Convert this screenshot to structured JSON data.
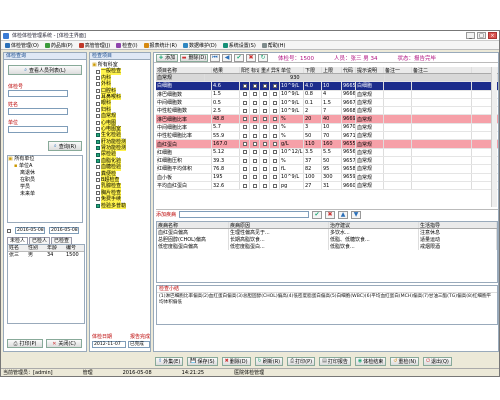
{
  "window": {
    "title": "体检体检管理系统 - [体检主界面]"
  },
  "menu": [
    {
      "label": "体检管理(O)",
      "color": "#2b6fb8"
    },
    {
      "label": "药品库(P)",
      "color": "#3a9a3a"
    },
    {
      "label": "高管管理(J)",
      "color": "#c0392b"
    },
    {
      "label": "检查(I)",
      "color": "#8e44ad"
    },
    {
      "label": "报表统计(R)",
      "color": "#d68910"
    },
    {
      "label": "数据维护(D)",
      "color": "#2e86c1"
    },
    {
      "label": "系统设置(S)",
      "color": "#148f77"
    },
    {
      "label": "帮助(H)",
      "color": "#7f8c8d"
    }
  ],
  "left": {
    "header": "体检查询",
    "person_button": "查看人员列表(L)",
    "fields": [
      {
        "label": "体检号"
      },
      {
        "label": "姓名"
      },
      {
        "label": "单位"
      }
    ],
    "search_button": "查询(R)",
    "tree": [
      "所有单位",
      "单位A",
      "离退休",
      "在职员",
      "学员",
      "未来单"
    ],
    "date_from": "2016-05-08",
    "date_to": "2016-05-08",
    "tabs": [
      "未检人",
      "已检人",
      "已检查"
    ],
    "list_header": [
      "姓名",
      "性别",
      "年龄",
      "编号"
    ],
    "list_rows": [
      [
        "张三",
        "男",
        "34",
        "1500"
      ]
    ],
    "print_button": "打印(P)",
    "close_button": "关闭(C)"
  },
  "middle": {
    "header": "检查项目",
    "dept_root": "所有科室",
    "depts": [
      "一般检查",
      "内科",
      "外科",
      "口腔科",
      "耳鼻喉科",
      "眼科",
      "妇科",
      "血常规",
      "心电图",
      "心电图室",
      "生化检验",
      "肝功能检测",
      "肾功能检测",
      "尿检验",
      "血脂化验",
      "血糖检验",
      "粪便检",
      "B超检查",
      "乳腺检查",
      "胸片检查",
      "免费手续",
      "检验多普勒"
    ],
    "checked": [
      false,
      false,
      false,
      false,
      false,
      false,
      false,
      false,
      false,
      false,
      true,
      true,
      true,
      true,
      true,
      false,
      false,
      false,
      false,
      false,
      false,
      true
    ],
    "exam_date_label": "体检日期",
    "exam_date": "2012-11-07",
    "report_label": "报告完成",
    "report_val": "已完成"
  },
  "right": {
    "header": "检查项目",
    "tool_labels": [
      "添加",
      "删除(D)"
    ],
    "info": "体检号：1500",
    "info2": "人员：张三  男  34",
    "info3": "状态：报告完毕",
    "grid_header": [
      "项目名称",
      "结果",
      "阳性",
      "标记",
      "重点",
      "异常",
      "单位",
      "下限",
      "上限",
      "代码",
      "提示说明",
      "备注一",
      "备注二"
    ],
    "section": "血常规",
    "section_val": "930",
    "rows": [
      {
        "cells": [
          "白细胞",
          "4.6",
          "",
          "",
          "",
          "",
          "10^9/L",
          "4.0",
          "10",
          "9665",
          "白细胞",
          "",
          ""
        ],
        "style": "sel"
      },
      {
        "cells": [
          "淋巴细胞数",
          "1.5",
          "",
          "",
          "",
          "",
          "10^9/L",
          "0.8",
          "4",
          "9666",
          "血常规",
          "",
          ""
        ],
        "style": "wh"
      },
      {
        "cells": [
          "中间细胞数",
          "0.5",
          "",
          "",
          "",
          "",
          "10^9/L",
          "0.1",
          "1.5",
          "9667",
          "血常规",
          "",
          ""
        ],
        "style": "wh"
      },
      {
        "cells": [
          "中性粒细胞数",
          "2.5",
          "",
          "",
          "",
          "",
          "10^9/L",
          "2",
          "7",
          "9668",
          "血常规",
          "",
          ""
        ],
        "style": "wh"
      },
      {
        "cells": [
          "淋巴细胞比率",
          "48.8",
          "",
          "",
          "",
          "",
          "%",
          "20",
          "40",
          "9669",
          "血常规",
          "",
          ""
        ],
        "style": "red"
      },
      {
        "cells": [
          "中间细胞比率",
          "5.7",
          "",
          "",
          "",
          "",
          "%",
          "3",
          "10",
          "9670",
          "血常规",
          "",
          ""
        ],
        "style": "wh"
      },
      {
        "cells": [
          "中性粒细胞比率",
          "55.9",
          "",
          "",
          "",
          "",
          "%",
          "50",
          "70",
          "9671",
          "血常规",
          "",
          ""
        ],
        "style": "wh"
      },
      {
        "cells": [
          "血红蛋白",
          "167.0",
          "",
          "",
          "",
          "",
          "g/L",
          "110",
          "160",
          "9655",
          "血常规",
          "",
          ""
        ],
        "style": "red"
      },
      {
        "cells": [
          "红细胞",
          "5.12",
          "",
          "",
          "",
          "",
          "10^12/L",
          "3.5",
          "5.5",
          "9656",
          "血常规",
          "",
          ""
        ],
        "style": "wh"
      },
      {
        "cells": [
          "红细胞压积",
          "39.3",
          "",
          "",
          "",
          "",
          "%",
          "37",
          "50",
          "9657",
          "血常规",
          "",
          ""
        ],
        "style": "wh"
      },
      {
        "cells": [
          "红细胞平均体积",
          "76.8",
          "",
          "",
          "",
          "",
          "fL",
          "82",
          "95",
          "9658",
          "血常规",
          "",
          ""
        ],
        "style": "wh"
      },
      {
        "cells": [
          "血小板",
          "195",
          "",
          "",
          "",
          "",
          "10^9/L",
          "100",
          "300",
          "9659",
          "血常规",
          "",
          ""
        ],
        "style": "wh"
      },
      {
        "cells": [
          "平均血红蛋白",
          "32.6",
          "",
          "",
          "",
          "",
          "pg",
          "27",
          "31",
          "9660",
          "血常规",
          "",
          ""
        ],
        "style": "wh"
      }
    ],
    "add_label": "添加疾病",
    "diag_header": [
      "疾病名称",
      "疾病原因",
      "治疗建议",
      "生活指导"
    ],
    "diag_rows": [
      [
        "血红蛋白偏高",
        "生理性偏高见于...",
        "多饮水...",
        "注意休息"
      ],
      [
        "总胆固醇(CHOL)偏高",
        "长期高脂饮食...",
        "低脂、低糖饮食...",
        "适量运动"
      ],
      [
        "低密度脂蛋白偏高",
        "低密度脂蛋白...",
        "低脂饮食...",
        "戒烟限酒"
      ]
    ],
    "summary_label": "检查小结",
    "summary_text": "(1)淋巴细胞比率偏高(2)血红蛋白偏高(3)总胆固醇(CHOL)偏高(4)低密度脂蛋白偏高(5)白细胞(WBC)(6)平均血红蛋白(MCH)偏高(7)甘油三酯(TG)偏高(8)红细胞平均体积偏低"
  },
  "bottom": {
    "buttons": [
      "外集(E)",
      "保存(S)",
      "删除(D)",
      "刷新(R)",
      "打印(P)",
      "打印报告",
      "体检结束",
      "重检(N)",
      "退出(Q)"
    ],
    "status": [
      "当前管理员：[admin]",
      "管理",
      "2016-05-08",
      "14:21:25",
      "医院体检管理"
    ]
  }
}
